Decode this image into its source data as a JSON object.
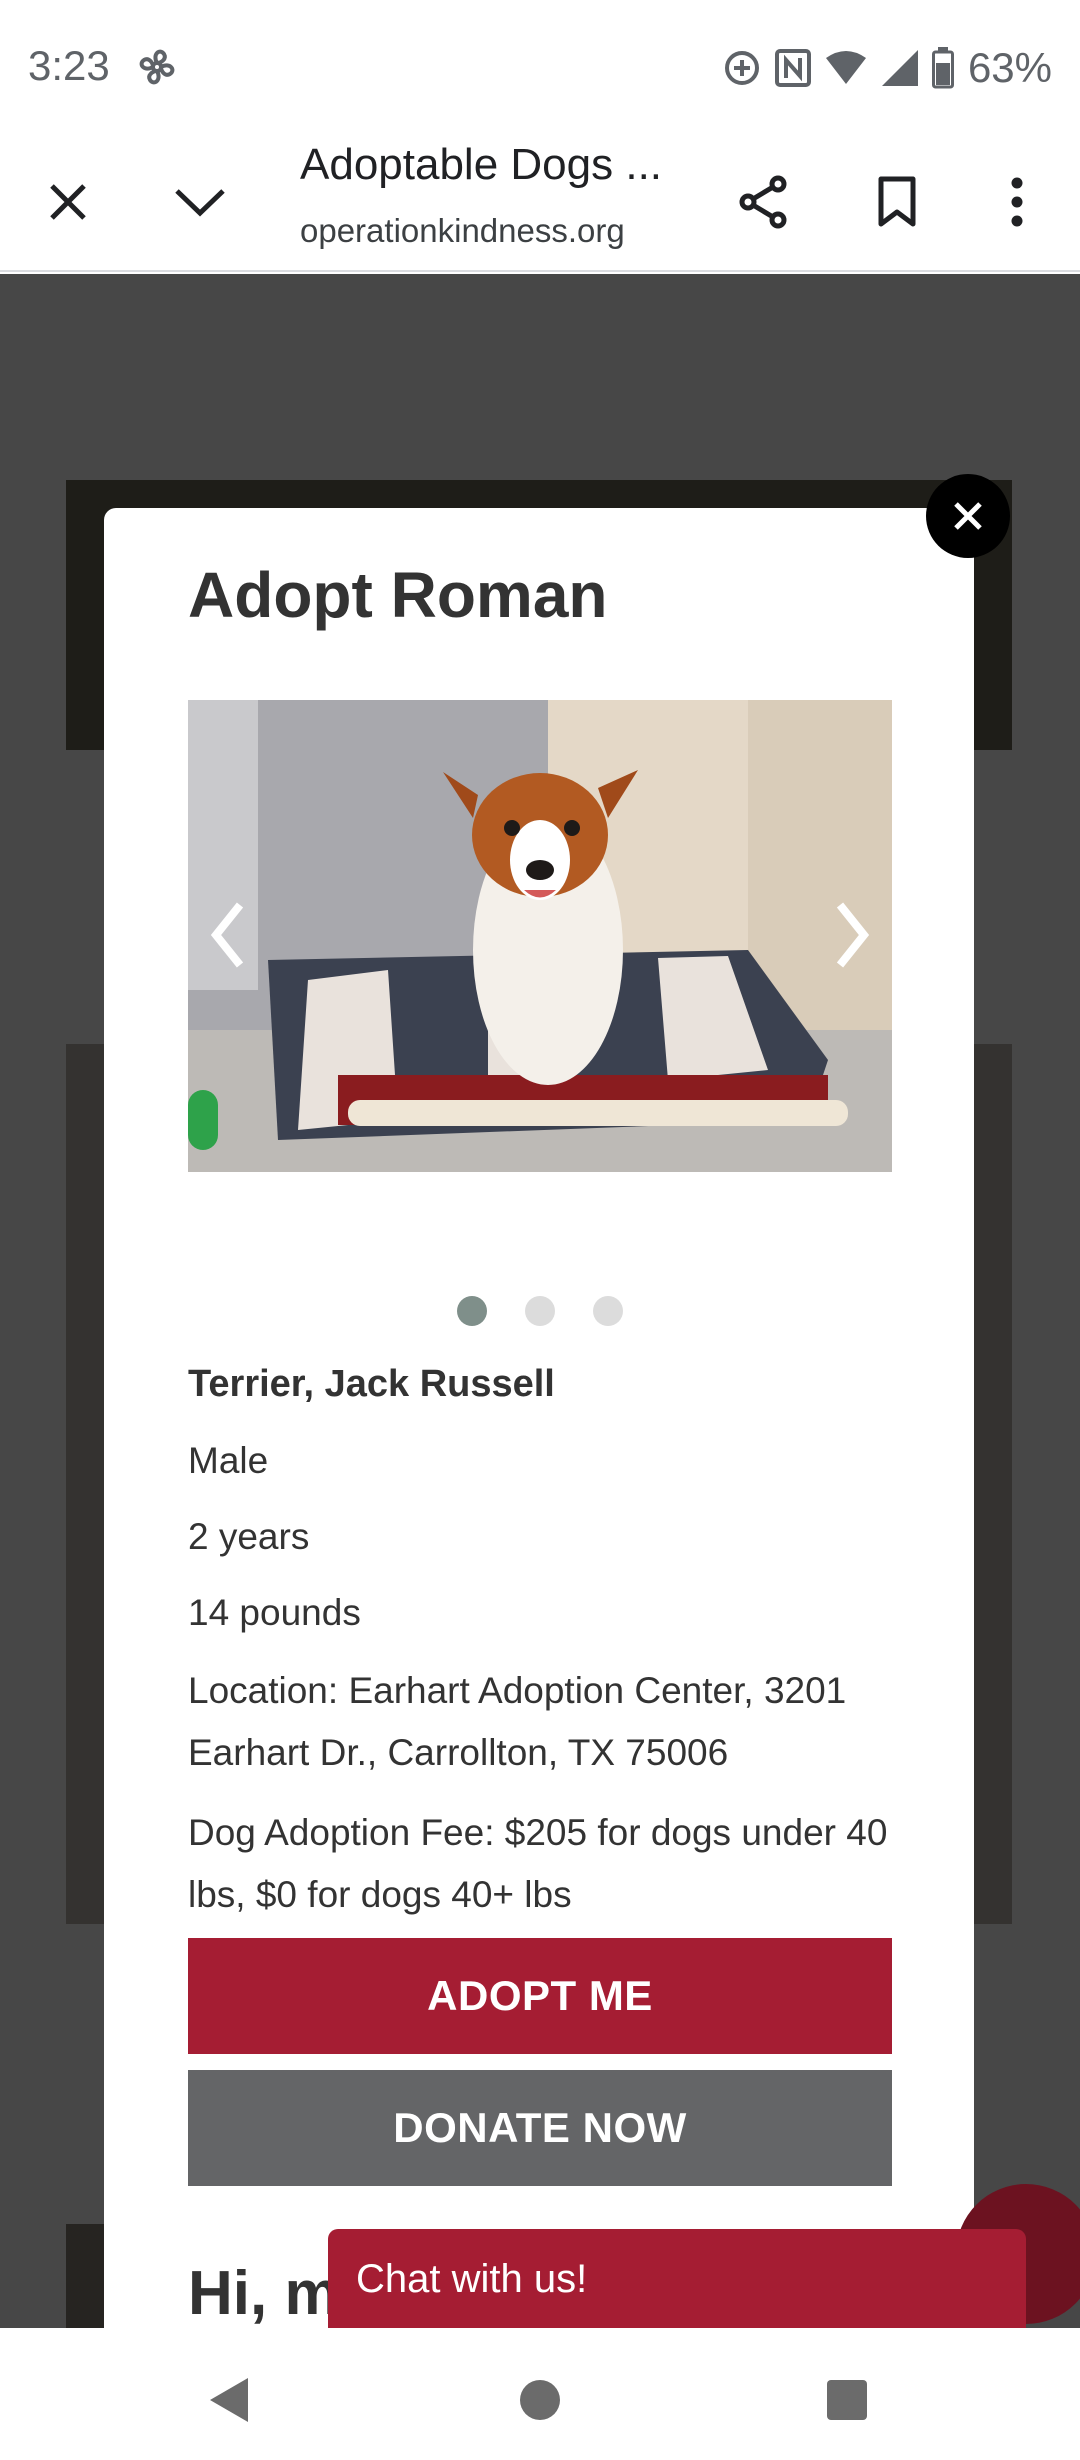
{
  "status_bar": {
    "time": "3:23",
    "battery": "63%"
  },
  "browser": {
    "title": "Adoptable Dogs ...",
    "url": "operationkindness.org"
  },
  "modal": {
    "title": "Adopt Roman",
    "photo_count": 3,
    "active_photo": 1,
    "breed": "Terrier, Jack Russell",
    "sex": "Male",
    "age": "2 years",
    "weight": "14 pounds",
    "location": "Location: Earhart Adoption Center, 3201 Earhart Dr., Carrollton, TX 75006",
    "fee": "Dog Adoption Fee: $205 for dogs under 40 lbs, $0 for dogs 40+ lbs",
    "adopt_label": "ADOPT ME",
    "donate_label": "DONATE NOW",
    "greeting_partial": "Hi, m"
  },
  "chat": {
    "label": "Chat with us!"
  },
  "colors": {
    "brand_red": "#a51d33",
    "donate_gray": "#646567",
    "active_dot": "#7f8f8a"
  },
  "icons": {
    "status": [
      "fan-icon",
      "data-saver-icon",
      "nfc-icon",
      "wifi-icon",
      "signal-icon",
      "battery-icon"
    ],
    "toolbar": [
      "close-icon",
      "chevron-down-icon",
      "share-icon",
      "bookmark-icon",
      "more-vert-icon"
    ],
    "nav": [
      "back-icon",
      "home-icon",
      "recents-icon"
    ]
  }
}
